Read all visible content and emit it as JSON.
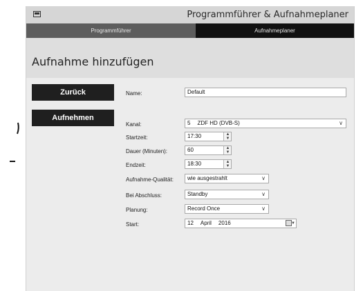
{
  "window": {
    "title": "Programmführer & Aufnahmeplaner"
  },
  "tabs": [
    "Programmführer",
    "Aufnahmeplaner"
  ],
  "page": {
    "title": "Aufnahme hinzufügen"
  },
  "sidebar": {
    "back_label": "Zurück",
    "record_label": "Aufnehmen"
  },
  "form": {
    "name_label": "Name:",
    "name_value": "Default",
    "channel_label": "Kanal:",
    "channel_value": "5",
    "channel_name": "ZDF HD  (DVB-S)",
    "start_time_label": "Startzeit:",
    "start_time_value": "17:30",
    "duration_label": "Dauer (Minuten):",
    "duration_value": "60",
    "end_time_label": "Endzeit:",
    "end_time_value": "18:30",
    "quality_label": "Aufnahme-Qualität:",
    "quality_value": "wie ausgestrahlt",
    "after_label": "Bei Abschluss:",
    "after_value": "Standby",
    "schedule_label": "Planung:",
    "schedule_value": "Record Once",
    "start_label": "Start:",
    "start_day": "12",
    "start_month": "April",
    "start_year": "2016"
  },
  "colors": {
    "button_bg": "#1f1f1f",
    "tab_active_bg": "#111111",
    "tab_inactive_bg": "#5d5d5d"
  }
}
